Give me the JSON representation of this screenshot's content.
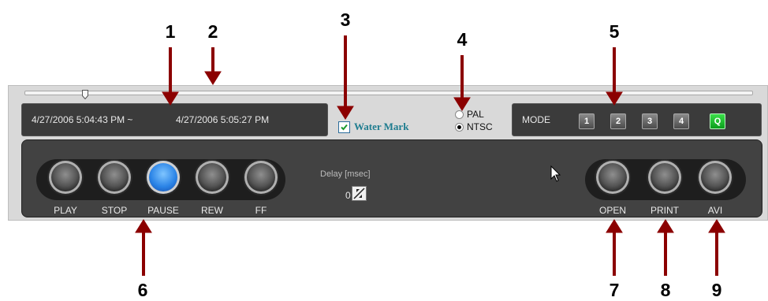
{
  "callouts": [
    "1",
    "2",
    "3",
    "4",
    "5",
    "6",
    "7",
    "8",
    "9"
  ],
  "time_range": {
    "start": "4/27/2006 5:04:43 PM ~",
    "end": "4/27/2006 5:05:27 PM"
  },
  "watermark": {
    "label": "Water Mark",
    "checked": true
  },
  "video_standard": {
    "options": [
      "PAL",
      "NTSC"
    ],
    "selected": "NTSC"
  },
  "mode": {
    "label": "MODE",
    "buttons": [
      "1",
      "2",
      "3",
      "4",
      "Q"
    ],
    "active": "Q"
  },
  "playback": {
    "buttons": [
      "PLAY",
      "STOP",
      "PAUSE",
      "REW",
      "FF"
    ],
    "active": "PAUSE"
  },
  "delay": {
    "label": "Delay [msec]",
    "value": "0"
  },
  "output": {
    "buttons": [
      "OPEN",
      "PRINT",
      "AVI"
    ]
  },
  "colors": {
    "callout_arrow": "#8b0000",
    "panel_dark": "#424242",
    "mode_active": "#1fc12f",
    "watermark_text": "#1e7c8f"
  },
  "icons": [
    "slider-thumb-icon",
    "checkbox-checked-icon",
    "radio-selected-icon",
    "spin-arrows-icon",
    "mouse-cursor-icon"
  ]
}
